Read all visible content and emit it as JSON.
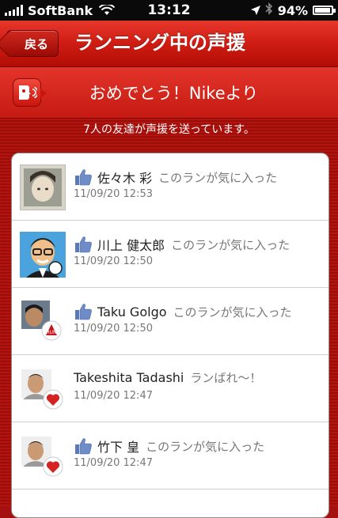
{
  "status_bar": {
    "carrier": "SoftBank",
    "time": "13:12",
    "battery": "94%",
    "battery_level": 0.94
  },
  "nav": {
    "back_label": "戻る",
    "title": "ランニング中の声援"
  },
  "banner": {
    "text": "おめでとう！Nikeより"
  },
  "friends_count_text": "7人の友達が声援を送っています。",
  "cheers": [
    {
      "name": "佐々木 彩",
      "message": "このランが気に入った",
      "timestamp": "11/09/20 12:53",
      "like": true,
      "avatar": "photo-girl"
    },
    {
      "name": "川上 健太郎",
      "message": "このランが気に入った",
      "timestamp": "11/09/20 12:50",
      "like": true,
      "avatar": "cartoon-man"
    },
    {
      "name": "Taku Golgo",
      "message": "このランが気に入った",
      "timestamp": "11/09/20 12:50",
      "like": true,
      "avatar": "photo-run"
    },
    {
      "name": "Takeshita Tadashi",
      "message": "ランばれ〜！",
      "timestamp": "11/09/20 12:47",
      "like": false,
      "avatar": "photo-man-heart"
    },
    {
      "name": "竹下 皇",
      "message": "このランが気に入った",
      "timestamp": "11/09/20 12:47",
      "like": true,
      "avatar": "photo-man-heart"
    }
  ]
}
